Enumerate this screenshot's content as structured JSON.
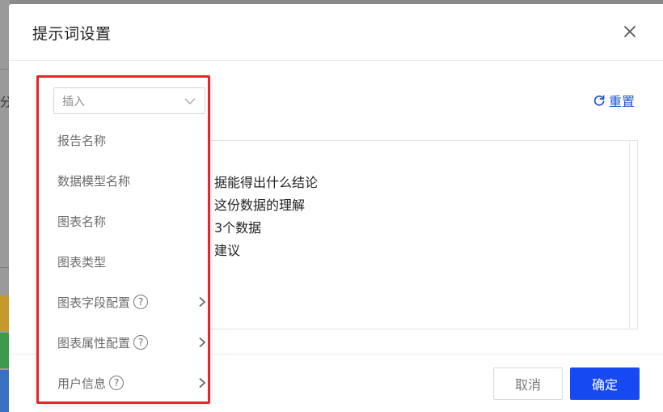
{
  "background": {
    "tab_fragment": "分"
  },
  "dialog": {
    "title": "提示词设置",
    "reset_label": "重置",
    "editor_lines": [
      "据能得出什么结论",
      "这份数据的理解",
      "3个数据",
      "建议"
    ],
    "cancel_label": "取消",
    "ok_label": "确定"
  },
  "insert_menu": {
    "placeholder": "插入",
    "items": [
      {
        "label": "报告名称"
      },
      {
        "label": "数据模型名称"
      },
      {
        "label": "图表名称"
      },
      {
        "label": "图表类型"
      },
      {
        "label": "图表字段配置",
        "help": "?"
      },
      {
        "label": "图表属性配置",
        "help": "?"
      },
      {
        "label": "用户信息",
        "help": "?"
      }
    ]
  },
  "colors": {
    "accent": "#1749f0",
    "link": "#1f54d6",
    "highlight_frame": "#e8252a",
    "stripe_yellow": "#c59a2a",
    "stripe_green": "#3c9a4c",
    "stripe_blue": "#3a6fc4"
  }
}
